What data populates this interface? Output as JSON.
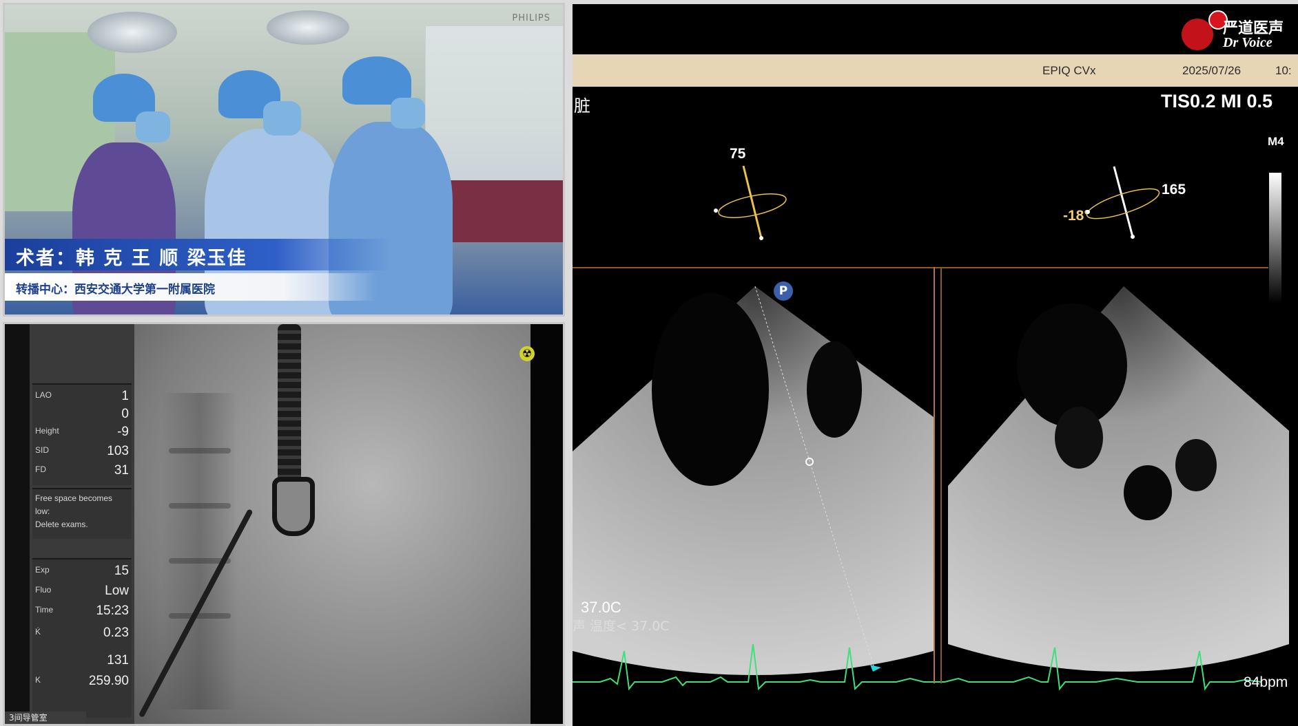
{
  "video": {
    "brand": "PHILIPS",
    "caption_surgeons": "术者：韩 克 王 顺 梁玉佳",
    "caption_center": "转播中心：西安交通大学第一附属医院"
  },
  "fluoro": {
    "rows_top": [
      {
        "label": "LAO",
        "value": "1"
      },
      {
        "label": "",
        "value": "0"
      },
      {
        "label": "Height",
        "value": "-9"
      },
      {
        "label": "SID",
        "value": "103"
      },
      {
        "label": "FD",
        "value": "31"
      }
    ],
    "message": [
      "Free space becomes",
      "low:",
      "Delete exams."
    ],
    "rows_bottom": [
      {
        "label": "Exp",
        "value": "15"
      },
      {
        "label": "Fluo",
        "value": "Low"
      },
      {
        "label": "Time",
        "value": "15:23"
      },
      {
        "label": "K̇",
        "value": "0.23"
      },
      {
        "label": "",
        "value": "131"
      },
      {
        "label": "K",
        "value": "259.90"
      }
    ],
    "status_tab": "3间导管室",
    "radiation_icon": "radiation-icon"
  },
  "echo": {
    "logo_cn": "严道医声",
    "logo_en": "Dr Voice",
    "model": "EPIQ CVx",
    "date": "2025/07/26",
    "time": "10:",
    "side_char": "脏",
    "tis_mi": "TIS0.2   MI 0.5",
    "m4": "M4",
    "angle_left": "75",
    "angle_right": "165",
    "angle_neg": "-18°",
    "p_badge": "P",
    "temp1": "37.0C",
    "temp2": "声 温度< 37.0C",
    "bpm": "84bpm",
    "colors": {
      "header": "#e7d6b5",
      "ecg": "#3fe07a",
      "divider": "#b8733a"
    }
  }
}
